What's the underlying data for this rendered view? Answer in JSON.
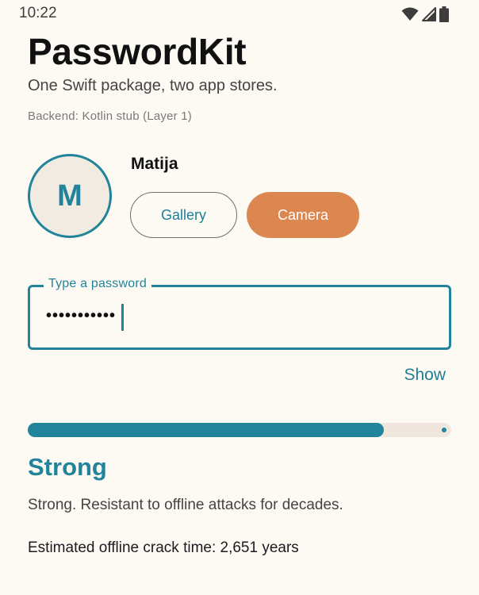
{
  "status_bar": {
    "time": "10:22",
    "icons": [
      "wifi-icon",
      "signal-icon",
      "battery-icon"
    ]
  },
  "app": {
    "title": "PasswordKit",
    "subtitle": "One Swift package, two app stores.",
    "backend_note": "Backend: Kotlin stub (Layer 1)"
  },
  "profile": {
    "avatar_letter": "M",
    "name": "Matija",
    "gallery_label": "Gallery",
    "camera_label": "Camera"
  },
  "password": {
    "label": "Type a password",
    "masked_value": "•••••••••••",
    "show_label": "Show"
  },
  "strength": {
    "level": 0.84,
    "label": "Strong",
    "description": "Strong. Resistant to offline attacks for decades.",
    "crack_time": "Estimated offline crack time: 2,651 years"
  },
  "colors": {
    "accent": "#22849b",
    "camera_button": "#dc8750",
    "background": "#fdfaf4",
    "track": "#efe7de"
  }
}
